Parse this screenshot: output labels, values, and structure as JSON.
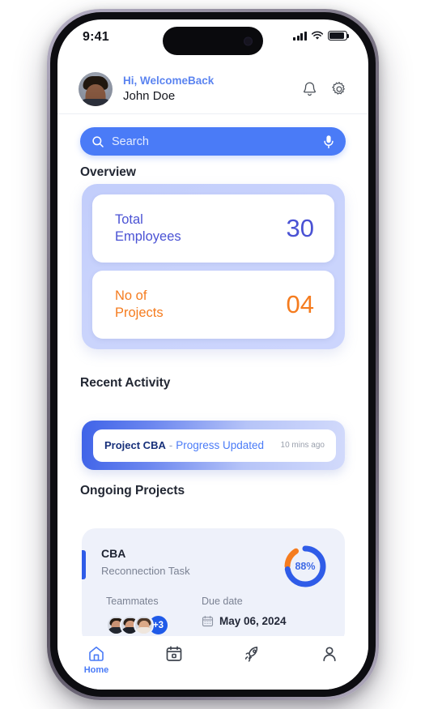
{
  "status_bar": {
    "time": "9:41",
    "signal_icon": "cellular-bars-icon",
    "wifi_icon": "wifi-icon",
    "battery_icon": "battery-icon"
  },
  "header": {
    "greeting": "Hi, WelcomeBack",
    "user_name": "John Doe",
    "avatar_name": "user-avatar",
    "bell_icon": "bell-icon",
    "gear_icon": "gear-icon"
  },
  "search": {
    "placeholder": "Search",
    "value": "",
    "search_icon": "search-icon",
    "mic_icon": "microphone-icon"
  },
  "overview": {
    "title": "Overview",
    "cards": [
      {
        "label": "Total\nEmployees",
        "label_line1": "Total",
        "label_line2": "Employees",
        "value": "30",
        "color": "#4a52d4"
      },
      {
        "label": "No of Projects",
        "label_line1": "No of",
        "label_line2": "Projects",
        "value": "04",
        "color": "#f57c1f"
      }
    ]
  },
  "recent_activity": {
    "title": "Recent Activity",
    "items": [
      {
        "project": "Project CBA",
        "separator": "-",
        "status": "Progress Updated",
        "time": "10 mins ago"
      }
    ]
  },
  "ongoing_projects": {
    "title": "Ongoing Projects",
    "projects": [
      {
        "name": "CBA",
        "task": "Reconnection Task",
        "progress_label": "88%",
        "progress_value": 88,
        "teammates_label": "Teammates",
        "teammates_extra": "+3",
        "due_label": "Due date",
        "due_date": "May 06, 2024",
        "calendar_icon": "calendar-icon"
      }
    ]
  },
  "bottom_nav": {
    "items": [
      {
        "label": "Home",
        "icon": "home-icon",
        "active": true
      },
      {
        "label": "",
        "icon": "calendar-icon",
        "active": false
      },
      {
        "label": "",
        "icon": "rocket-icon",
        "active": false
      },
      {
        "label": "",
        "icon": "person-icon",
        "active": false
      }
    ]
  },
  "colors": {
    "primary_blue": "#4a7bf7",
    "deep_blue": "#2f5ce8",
    "indigo": "#4a52d4",
    "orange": "#f57c1f",
    "overview_bg": "#c9d3fc",
    "card_bg": "#eef1fa"
  }
}
